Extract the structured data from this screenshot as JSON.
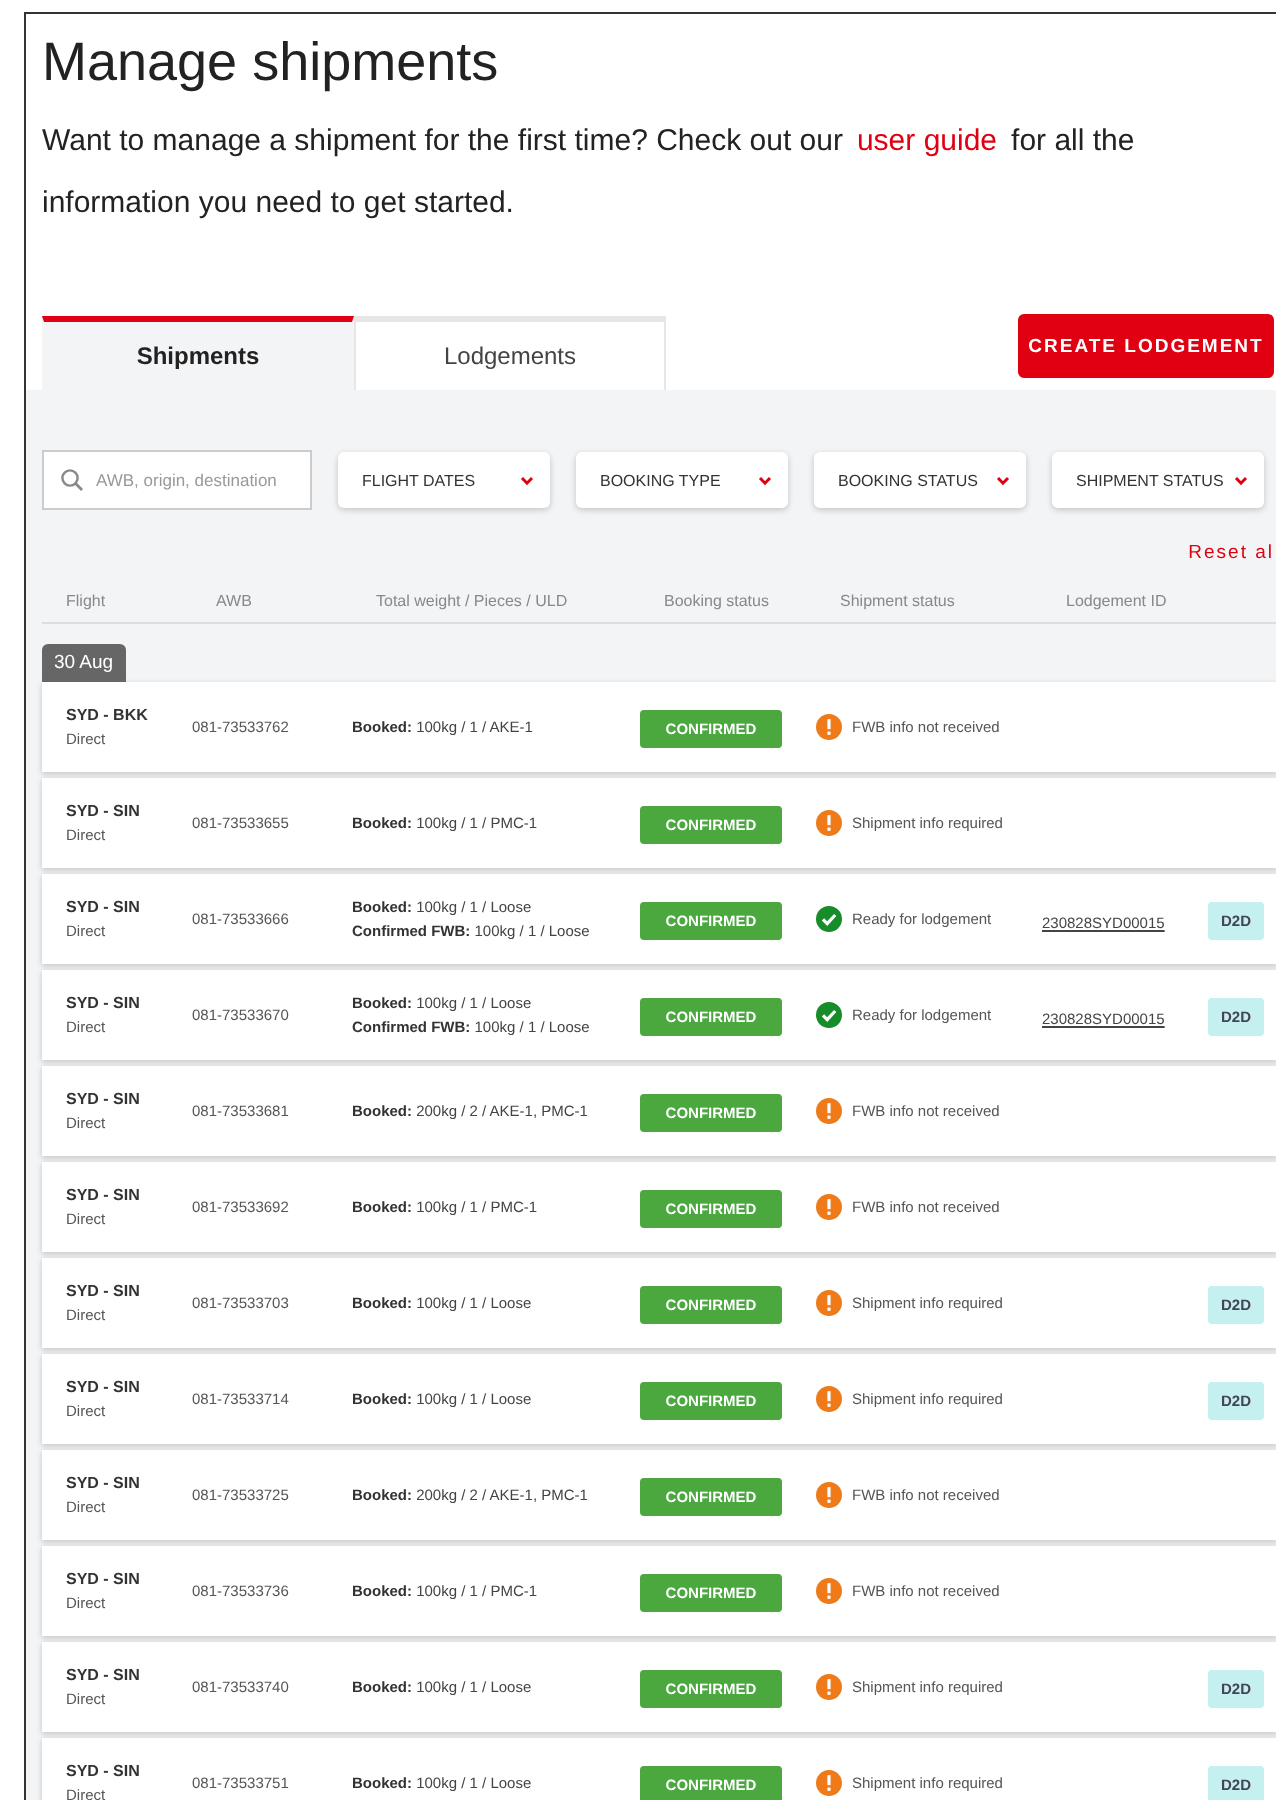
{
  "title": "Manage shipments",
  "intro": {
    "before": "Want to manage a shipment for the first time? Check out our",
    "link": "user guide",
    "after": "for all the",
    "line2": "information you need to get started."
  },
  "tabs": [
    {
      "label": "Shipments",
      "selected": true
    },
    {
      "label": "Lodgements",
      "selected": false
    }
  ],
  "create_button": "CREATE LODGEMENT",
  "search": {
    "placeholder": "AWB, origin, destination"
  },
  "filters": [
    "FLIGHT DATES",
    "BOOKING TYPE",
    "BOOKING STATUS",
    "SHIPMENT STATUS"
  ],
  "reset": "Reset al",
  "columns": [
    "Flight",
    "AWB",
    "Total weight / Pieces / ULD",
    "Booking status",
    "Shipment status",
    "Lodgement ID"
  ],
  "date_group": "30 Aug",
  "rows": [
    {
      "flight": "SYD - BKK",
      "route": "Direct",
      "awb": "081-73533762",
      "weights": [
        {
          "label": "Booked:",
          "value": "100kg / 1 / AKE-1"
        }
      ],
      "booking": "CONFIRMED",
      "status": {
        "kind": "warning",
        "text": "FWB info not received"
      }
    },
    {
      "flight": "SYD - SIN",
      "route": "Direct",
      "awb": "081-73533655",
      "weights": [
        {
          "label": "Booked:",
          "value": "100kg / 1 / PMC-1"
        }
      ],
      "booking": "CONFIRMED",
      "status": {
        "kind": "warning",
        "text": "Shipment info required"
      }
    },
    {
      "flight": "SYD - SIN",
      "route": "Direct",
      "awb": "081-73533666",
      "weights": [
        {
          "label": "Booked:",
          "value": "100kg / 1 / Loose"
        },
        {
          "label": "Confirmed FWB:",
          "value": "100kg / 1 / Loose"
        }
      ],
      "booking": "CONFIRMED",
      "status": {
        "kind": "ok",
        "text": "Ready for lodgement"
      },
      "lodgement_id": "230828SYD00015",
      "tag": "D2D"
    },
    {
      "flight": "SYD - SIN",
      "route": "Direct",
      "awb": "081-73533670",
      "weights": [
        {
          "label": "Booked:",
          "value": "100kg / 1 / Loose"
        },
        {
          "label": "Confirmed FWB:",
          "value": "100kg / 1 / Loose"
        }
      ],
      "booking": "CONFIRMED",
      "status": {
        "kind": "ok",
        "text": "Ready for lodgement"
      },
      "lodgement_id": "230828SYD00015",
      "tag": "D2D"
    },
    {
      "flight": "SYD - SIN",
      "route": "Direct",
      "awb": "081-73533681",
      "weights": [
        {
          "label": "Booked:",
          "value": "200kg / 2 / AKE-1, PMC-1"
        }
      ],
      "booking": "CONFIRMED",
      "status": {
        "kind": "warning",
        "text": "FWB info not received"
      }
    },
    {
      "flight": "SYD - SIN",
      "route": "Direct",
      "awb": "081-73533692",
      "weights": [
        {
          "label": "Booked:",
          "value": "100kg / 1 / PMC-1"
        }
      ],
      "booking": "CONFIRMED",
      "status": {
        "kind": "warning",
        "text": "FWB info not received"
      }
    },
    {
      "flight": "SYD - SIN",
      "route": "Direct",
      "awb": "081-73533703",
      "weights": [
        {
          "label": "Booked:",
          "value": "100kg / 1 / Loose"
        }
      ],
      "booking": "CONFIRMED",
      "status": {
        "kind": "warning",
        "text": "Shipment info required"
      },
      "tag": "D2D"
    },
    {
      "flight": "SYD - SIN",
      "route": "Direct",
      "awb": "081-73533714",
      "weights": [
        {
          "label": "Booked:",
          "value": "100kg / 1 / Loose"
        }
      ],
      "booking": "CONFIRMED",
      "status": {
        "kind": "warning",
        "text": "Shipment info required"
      },
      "tag": "D2D"
    },
    {
      "flight": "SYD - SIN",
      "route": "Direct",
      "awb": "081-73533725",
      "weights": [
        {
          "label": "Booked:",
          "value": "200kg / 2 / AKE-1, PMC-1"
        }
      ],
      "booking": "CONFIRMED",
      "status": {
        "kind": "warning",
        "text": "FWB info not received"
      }
    },
    {
      "flight": "SYD - SIN",
      "route": "Direct",
      "awb": "081-73533736",
      "weights": [
        {
          "label": "Booked:",
          "value": "100kg / 1 / PMC-1"
        }
      ],
      "booking": "CONFIRMED",
      "status": {
        "kind": "warning",
        "text": "FWB info not received"
      }
    },
    {
      "flight": "SYD - SIN",
      "route": "Direct",
      "awb": "081-73533740",
      "weights": [
        {
          "label": "Booked:",
          "value": "100kg / 1 / Loose"
        }
      ],
      "booking": "CONFIRMED",
      "status": {
        "kind": "warning",
        "text": "Shipment info required"
      },
      "tag": "D2D"
    },
    {
      "flight": "SYD - SIN",
      "route": "Direct",
      "awb": "081-73533751",
      "weights": [
        {
          "label": "Booked:",
          "value": "100kg / 1 / Loose"
        }
      ],
      "booking": "CONFIRMED",
      "status": {
        "kind": "warning",
        "text": "Shipment info required"
      },
      "tag": "D2D"
    }
  ]
}
